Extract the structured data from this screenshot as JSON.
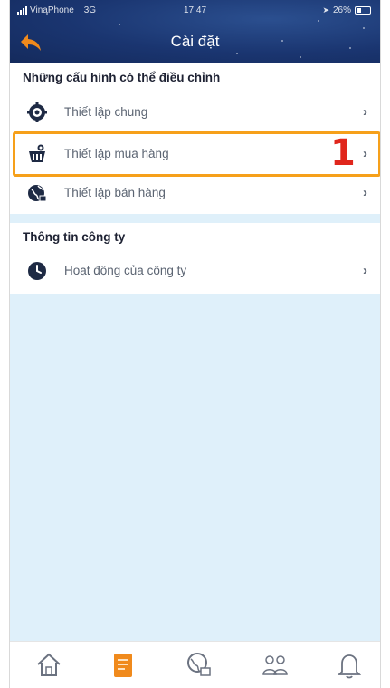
{
  "status_bar": {
    "carrier": "VinaPhone",
    "network": "3G",
    "time": "17:47",
    "battery": "26%"
  },
  "header": {
    "title": "Cài đặt",
    "back_icon": "back-arrow-icon"
  },
  "sections": [
    {
      "title": "Những cấu hình có thể điều chỉnh",
      "items": [
        {
          "label": "Thiết lập chung",
          "icon": "gear-icon"
        },
        {
          "label": "Thiết lập mua hàng",
          "icon": "shopping-basket-icon"
        },
        {
          "label": "Thiết lập bán hàng",
          "icon": "sales-globe-icon"
        }
      ]
    },
    {
      "title": "Thông tin công ty",
      "items": [
        {
          "label": "Hoạt động của công ty",
          "icon": "clock-icon"
        }
      ]
    }
  ],
  "annotation": {
    "step_number": "1",
    "highlight_color": "#f6a01a",
    "number_color": "#e0261c"
  },
  "bottom_nav": [
    {
      "icon": "home-icon",
      "active": false
    },
    {
      "icon": "document-icon",
      "active": true
    },
    {
      "icon": "globe-basket-icon",
      "active": false
    },
    {
      "icon": "users-icon",
      "active": false
    },
    {
      "icon": "bell-icon",
      "active": false
    }
  ],
  "colors": {
    "header_bg": "#1a3570",
    "background": "#dff0fa",
    "accent": "#f08a1c"
  }
}
